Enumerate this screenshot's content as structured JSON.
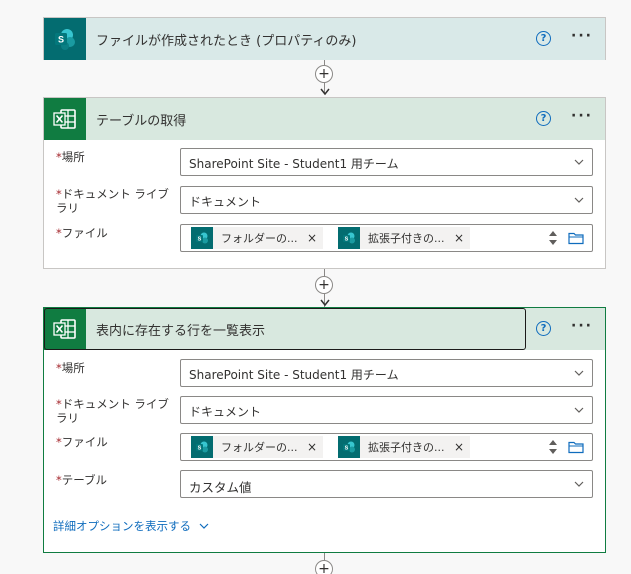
{
  "trigger": {
    "title": "ファイルが作成されたとき (プロパティのみ)"
  },
  "get_table": {
    "title": "テーブルの取得",
    "fields": {
      "location_label": "場所",
      "location_value": "SharePoint Site - Student1 用チーム",
      "library_label_line1": "ドキュメント ライブ",
      "library_label_line2": "ラリ",
      "library_value": "ドキュメント",
      "file_label": "ファイル",
      "chip1": "フォルダーの...",
      "chip2": "拡張子付きの..."
    }
  },
  "list_rows": {
    "title": "表内に存在する行を一覧表示",
    "fields": {
      "location_label": "場所",
      "location_value": "SharePoint Site - Student1 用チーム",
      "library_label_line1": "ドキュメント ライブ",
      "library_label_line2": "ラリ",
      "library_value": "ドキュメント",
      "file_label": "ファイル",
      "chip1": "フォルダーの...",
      "chip2": "拡張子付きの...",
      "table_label": "テーブル",
      "table_value": "カスタム値"
    },
    "advanced_link": "詳細オプションを表示する"
  },
  "common": {
    "required_mark": "*",
    "help_glyph": "?",
    "more_glyph": "···",
    "plus_glyph": "+",
    "chip_close": "×"
  },
  "colors": {
    "sharepoint": "#036c70",
    "excel": "#107c41",
    "link": "#0f6cbd",
    "required": "#a4262c"
  }
}
